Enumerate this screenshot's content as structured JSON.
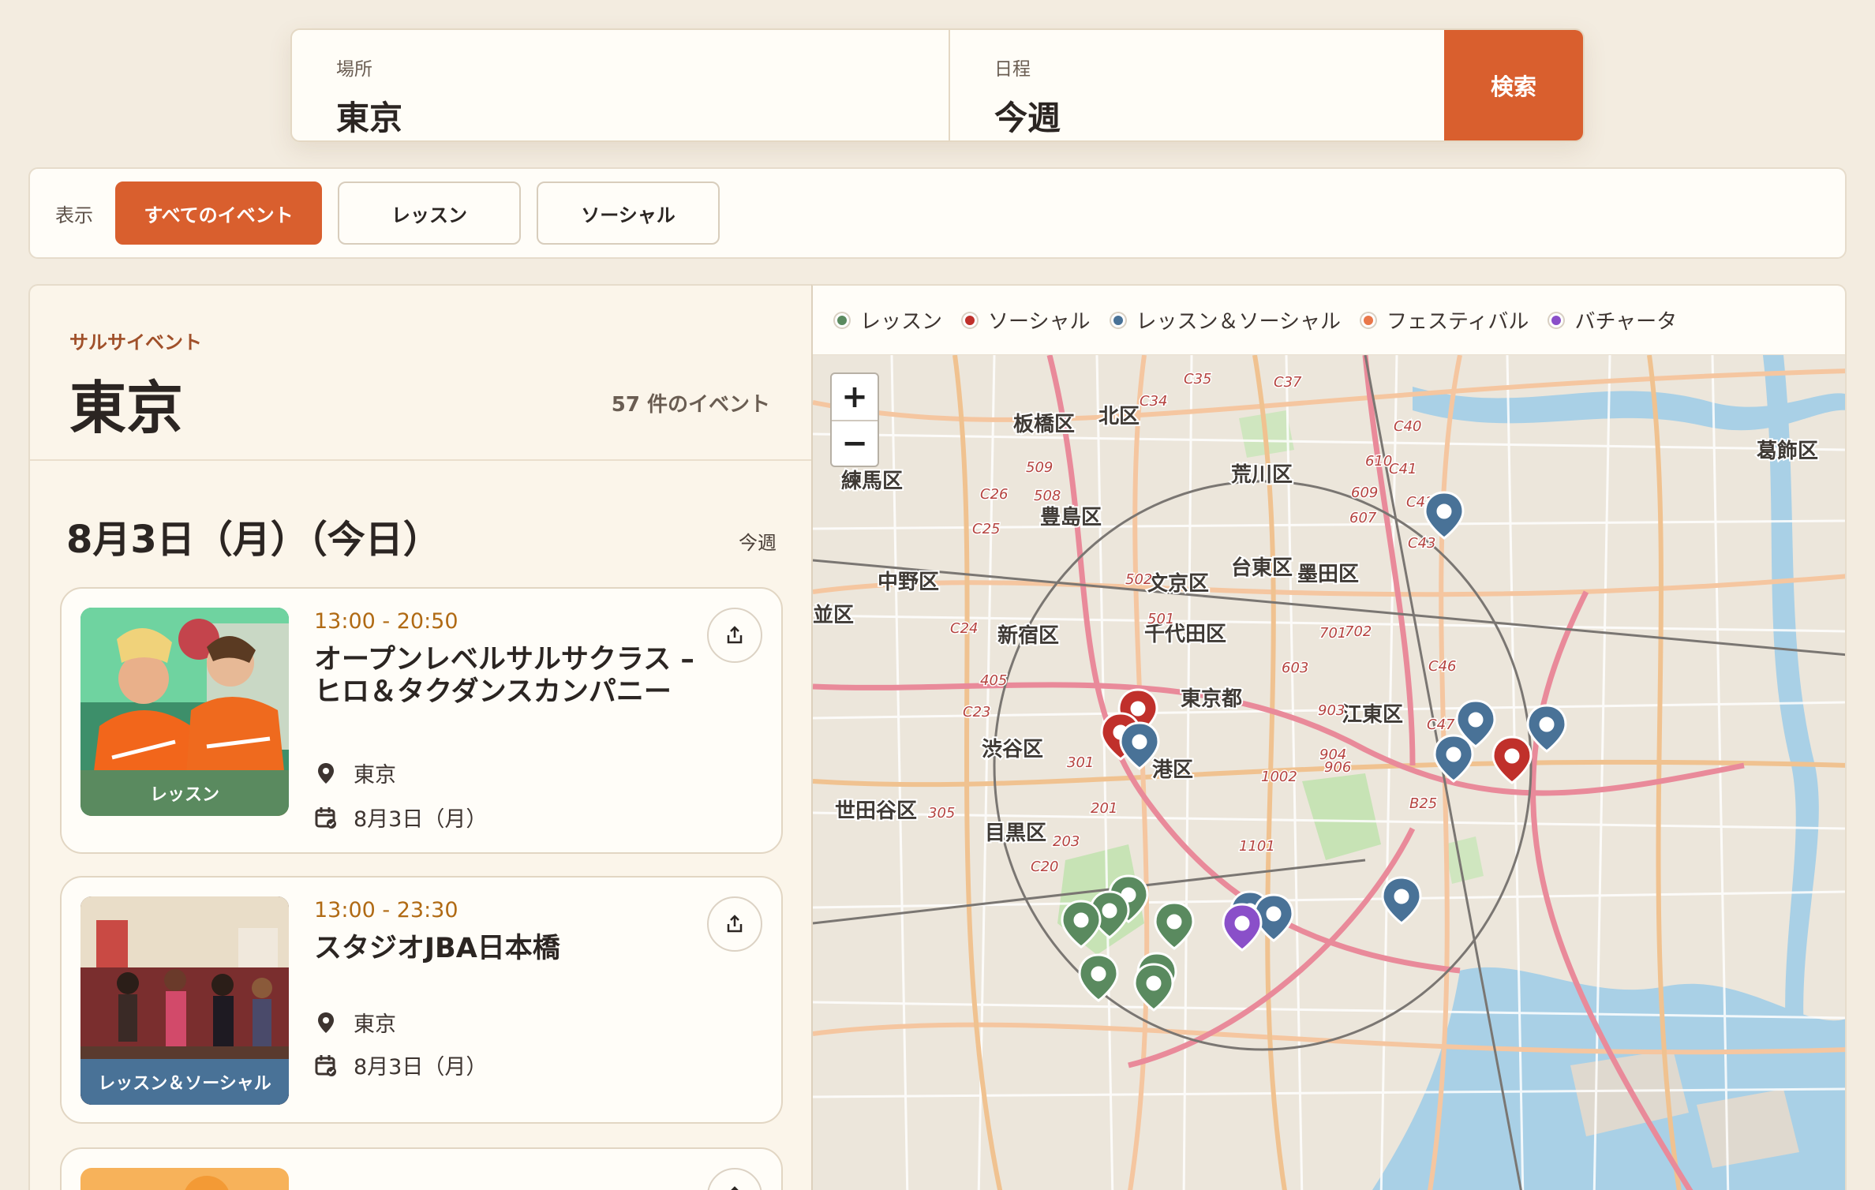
{
  "search": {
    "place_label": "場所",
    "place_value": "東京",
    "date_label": "日程",
    "date_value": "今週",
    "button": "検索"
  },
  "filters": {
    "label": "表示",
    "options": [
      "すべてのイベント",
      "レッスン",
      "ソーシャル"
    ],
    "active": "すべてのイベント"
  },
  "list": {
    "kicker": "サルサイベント",
    "city": "東京",
    "count": "57 件のイベント",
    "day_title": "8月3日（月）（今日）",
    "day_link": "今週",
    "events": [
      {
        "time": "13:00 - 20:50",
        "title": "オープンレベルサルサクラス – ヒロ＆タクダンスカンパニー",
        "location": "東京",
        "date": "8月3日（月）",
        "tag": "レッスン",
        "tag_color": "#5a8a5f"
      },
      {
        "time": "13:00 - 23:30",
        "title": "スタジオJBA日本橋",
        "location": "東京",
        "date": "8月3日（月）",
        "tag": "レッスン＆ソーシャル",
        "tag_color": "#497297"
      }
    ]
  },
  "legend": [
    {
      "label": "レッスン",
      "color": "#5a8a5f"
    },
    {
      "label": "ソーシャル",
      "color": "#c0302b"
    },
    {
      "label": "レッスン＆ソーシャル",
      "color": "#497297"
    },
    {
      "label": "フェスティバル",
      "color": "#e9774a"
    },
    {
      "label": "バチャータ",
      "color": "#8a4fc9"
    }
  ],
  "map": {
    "zoom_in": "+",
    "zoom_out": "−",
    "labels": {
      "itabashi": "板橋区",
      "kita": "北区",
      "nerima": "練馬区",
      "arakawa": "荒川区",
      "katsushika": "葛飾区",
      "toshima": "豊島区",
      "nakano": "中野区",
      "bunkyo": "文京区",
      "taito": "台東区",
      "sumida": "墨田区",
      "suginami": "並区",
      "shinjuku": "新宿区",
      "chiyoda": "千代田区",
      "tokyo": "東京都",
      "koto": "江東区",
      "shibuya": "渋谷区",
      "minato": "港区",
      "setagaya": "世田谷区",
      "meguro": "目黒区",
      "r_c35": "C35",
      "r_c37": "C37",
      "r_c34": "C34",
      "r_c40": "C40",
      "r_c41": "C41",
      "r_610": "610",
      "r_609": "609",
      "r_607": "607",
      "r_c42": "C42",
      "r_c43": "C43",
      "r_509": "509",
      "r_508": "508",
      "r_c26": "C26",
      "r_c25": "C25",
      "r_502": "502",
      "r_501": "501",
      "r_c24": "C24",
      "r_405": "405",
      "r_c23": "C23",
      "r_301": "301",
      "r_201": "201",
      "r_305": "305",
      "r_203": "203",
      "r_c20": "C20",
      "r_1002": "1002",
      "r_904": "904",
      "r_906": "906",
      "r_903": "903",
      "r_603": "603",
      "r_701": "701",
      "r_702": "702",
      "r_b25": "B25",
      "r_1101": "1101",
      "r_c47": "C47",
      "r_c46": "C46"
    }
  }
}
